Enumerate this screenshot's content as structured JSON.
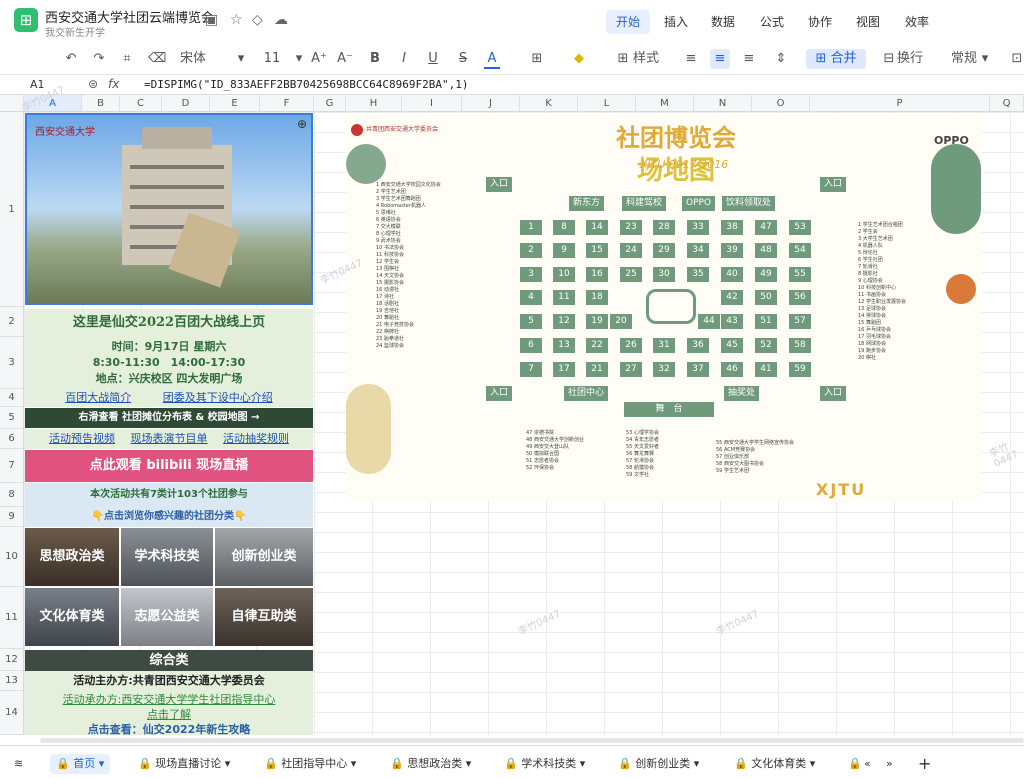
{
  "app": {
    "title": "西安交通大学社团云端博览会",
    "folder": "我交新生开学",
    "logo_glyph": "⊞",
    "menus": [
      "开始",
      "插入",
      "数据",
      "公式",
      "协作",
      "视图",
      "效率"
    ],
    "active_menu": "开始"
  },
  "toolbar": {
    "font": "宋体",
    "size": "11",
    "style_label": "样式",
    "merge_label": "合并",
    "wrap_label": "换行",
    "format_label": "常规",
    "bold": "B",
    "italic": "I",
    "underline": "U",
    "strike": "S",
    "fontcolor": "A"
  },
  "formula": {
    "cell": "A1",
    "fx": "fx",
    "content": "=DISPIMG(\"ID_833AEFF2BB70425698BCC64C8969F2BA\",1)"
  },
  "columns": [
    "A",
    "B",
    "C",
    "D",
    "E",
    "F",
    "G",
    "H",
    "I",
    "J",
    "K",
    "L",
    "M",
    "N",
    "O",
    "P",
    "Q"
  ],
  "rows": [
    "1",
    "2",
    "3",
    "4",
    "5",
    "6",
    "7",
    "8",
    "9",
    "10",
    "11",
    "12",
    "13",
    "14"
  ],
  "left": {
    "photo_caption": "西安交通大学",
    "r2": "这里是仙交2022百团大战线上页",
    "r3_time": "时间：9月17日 星期六",
    "r3_hours": "8:30-11:30　14:00-17:30",
    "r3_place": "地点：兴庆校区 四大发明广场",
    "r4_a": "百团大战简介",
    "r4_b": "团委及其下设中心介绍",
    "r5": "右滑查看 社团摊位分布表 & 校园地图 →",
    "r6_a": "活动预告视频",
    "r6_b": "现场表演节目单",
    "r6_c": "活动抽奖规则",
    "r7": "点此观看 bilibili 现场直播",
    "r8": "本次活动共有7类计103个社团参与",
    "r9": "👇点击浏览你感兴趣的社团分类👇",
    "cats": [
      "思想政治类",
      "学术科技类",
      "创新创业类",
      "文化体育类",
      "志愿公益类",
      "自律互助类"
    ],
    "r12": "综合类",
    "r13": "活动主办方:共青团西安交通大学委员会",
    "r14_a": "活动承办方:西安交通大学学生社团指导中心",
    "r14_b": "点击了解",
    "r15": "点击查看：仙交2022年新生攻略"
  },
  "map": {
    "header_left": "共青团西安交通大学委员会",
    "title": "社团博览会",
    "subtitle": "场地图",
    "sub_en": "XJTU 0917 2016",
    "brand": "OPPO",
    "entrance": "入口",
    "zones": [
      "新东方",
      "科建驾校",
      "OPPO",
      "饮料领取处"
    ],
    "center": "社团中心",
    "stage": "舞　台",
    "lottery": "抽奖处",
    "footer": "XJTU",
    "booths": [
      [
        1,
        8,
        14,
        23,
        28,
        33,
        38,
        47,
        53
      ],
      [
        2,
        9,
        15,
        24,
        29,
        34,
        39,
        48,
        54
      ],
      [
        3,
        10,
        16,
        25,
        30,
        35,
        40,
        49,
        55
      ],
      [
        4,
        11,
        18,
        42,
        50,
        56
      ],
      [
        5,
        12,
        19,
        20,
        44,
        43,
        51,
        57
      ],
      [
        6,
        13,
        22,
        26,
        31,
        36,
        45,
        52,
        58
      ],
      [
        7,
        17,
        21,
        27,
        32,
        37,
        46,
        41,
        59
      ]
    ],
    "list_left": [
      "1 西安交通大学校园文化协会",
      "2 学生艺术团",
      "3 学生艺术团舞蹈团",
      "4 Robomaster机器人",
      "5 思维社",
      "6 英语协会",
      "7 交大模联",
      "8 心理学社",
      "9 武术协会",
      "10 书法协会",
      "11 科技协会",
      "12 学生会",
      "13 围棋社",
      "14 天文协会",
      "15 摄影协会",
      "16 动漫社",
      "17 诗社",
      "18 话剧社",
      "19 吉他社",
      "20 舞蹈社",
      "21 电子竞技协会",
      "22 棋牌社",
      "23 跆拳道社",
      "24 篮球协会"
    ],
    "list_mid": [
      "47 崇德书院",
      "48 西安交通大学创新创业",
      "49 西安交大登山队",
      "50 模拟联合国",
      "51 志愿者协会",
      "52 环保协会"
    ],
    "list_mid2": [
      "53 心理学协会",
      "54 青年志愿者",
      "55 天文爱好者",
      "56 舞龙舞狮",
      "57 轮滑协会",
      "58 航模协会",
      "59 文学社"
    ],
    "list_right": [
      "55 西安交通大学学生网络宣传协会",
      "56 ACM竞赛协会",
      "57 创业俱乐部",
      "58 西安交大图书协会",
      "59 学生艺术团"
    ],
    "list_far": [
      "1 学生艺术团合唱团",
      "2 学生会",
      "3 大学生艺术团",
      "4 机器人队",
      "5 辩论社",
      "6 学生社团",
      "7 轮滑社",
      "8 摄影社",
      "9 心理协会",
      "10 科技创新中心",
      "11 书画协会",
      "12 学生职业发展协会",
      "13 足球协会",
      "14 排球协会",
      "15 舞蹈团",
      "16 乒乓球协会",
      "17 羽毛球协会",
      "18 网球协会",
      "19 跑步协会",
      "20 棋社"
    ]
  },
  "sheets": [
    "首页",
    "现场直播讨论",
    "社团指导中心",
    "思想政治类",
    "学术科技类",
    "创新创业类",
    "文化体育类"
  ],
  "active_sheet": "首页",
  "watermark": "李竹0447"
}
